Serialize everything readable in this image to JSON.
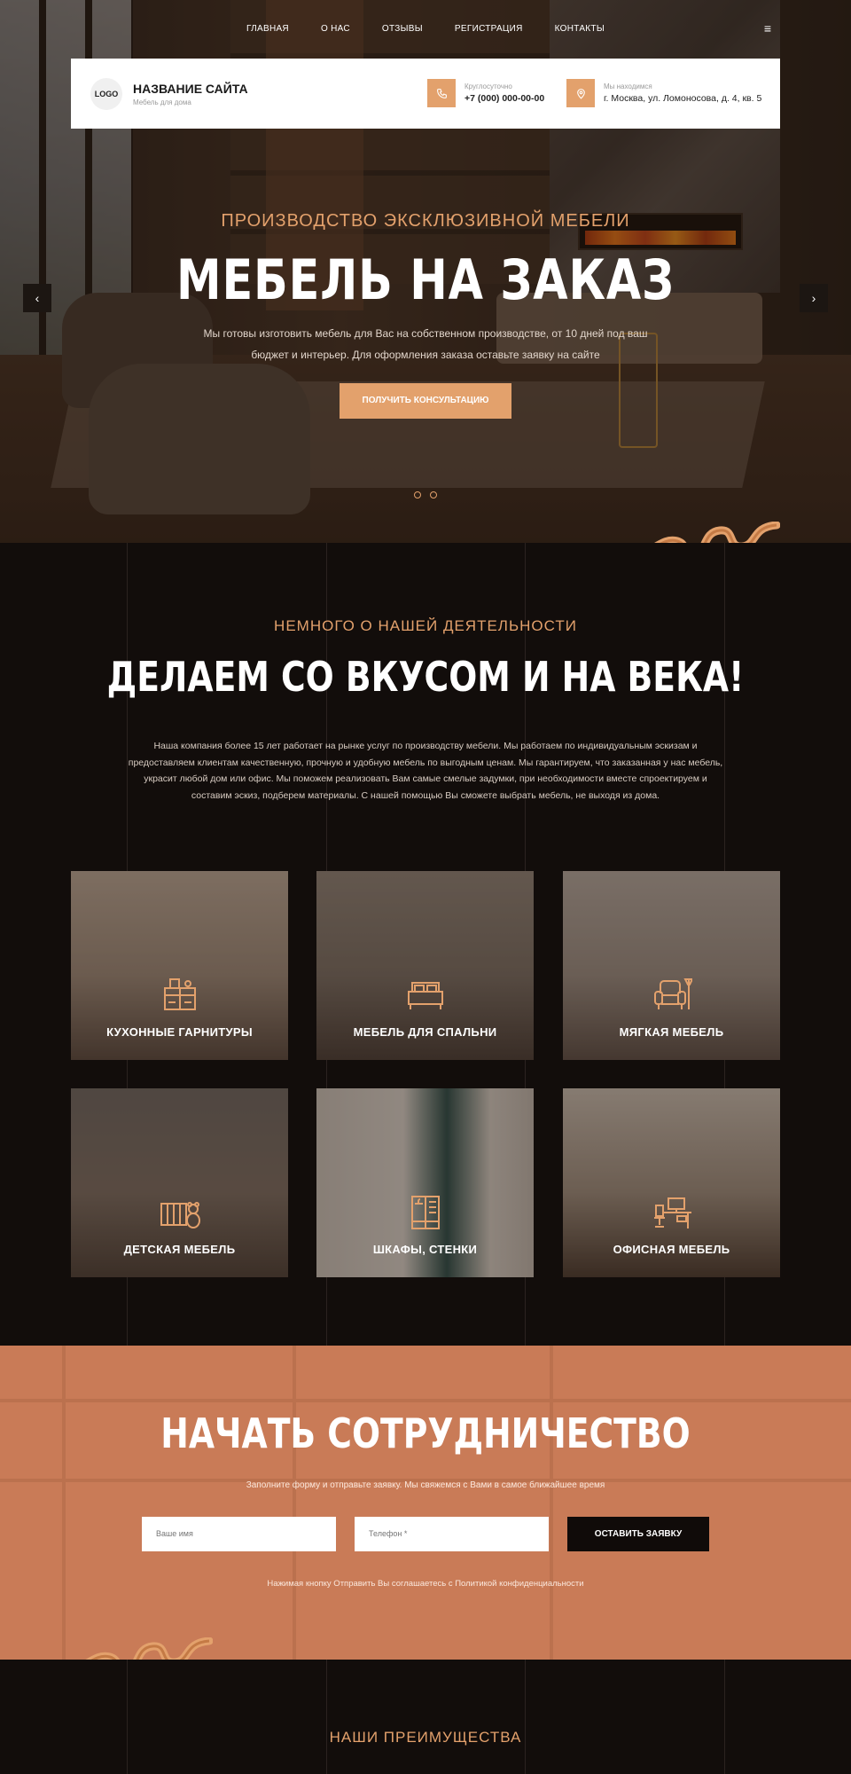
{
  "nav": {
    "items": [
      "ГЛАВНАЯ",
      "О НАС",
      "ОТЗЫВЫ",
      "РЕГИСТРАЦИЯ",
      "КОНТАКТЫ"
    ],
    "menu_icon": "hamburger-icon"
  },
  "header": {
    "logo": "LOGO",
    "site_name": "НАЗВАНИЕ САЙТА",
    "site_tagline": "Мебель для дома",
    "phone_label": "Круглосуточно",
    "phone": "+7 (000) 000-00-00",
    "address_label": "Мы находимся",
    "address": "г. Москва, ул. Ломоносова, д. 4, кв. 5"
  },
  "hero": {
    "subtitle": "ПРОИЗВОДСТВО ЭКСКЛЮЗИВНОЙ МЕБЕЛИ",
    "title": "МЕБЕЛЬ НА ЗАКАЗ",
    "description": "Мы готовы изготовить мебель для Вас на собственном производстве, от 10 дней под ваш бюджет и интерьер. Для оформления заказа оставьте заявку на сайте",
    "button": "ПОЛУЧИТЬ КОНСУЛЬТАЦИЮ",
    "prev_arrow": "‹",
    "next_arrow": "›",
    "slides_count": 2
  },
  "about": {
    "subtitle": "НЕМНОГО О НАШЕЙ ДЕЯТЕЛЬНОСТИ",
    "title": "ДЕЛАЕМ СО ВКУСОМ И НА ВЕКА!",
    "text": "Наша компания более 15 лет работает на рынке услуг по производству мебели. Мы работаем по индивидуальным эскизам и предоставляем клиентам качественную, прочную и удобную мебель по выгодным ценам. Мы гарантируем, что заказанная у нас мебель, украсит любой дом или офис. Мы поможем реализовать Вам самые смелые задумки, при необходимости вместе спроектируем и составим эскиз, подберем материалы. С нашей помощью Вы сможете выбрать мебель, не выходя из дома."
  },
  "categories": [
    {
      "label": "КУХОННЫЕ ГАРНИТУРЫ",
      "icon": "kitchen-icon"
    },
    {
      "label": "МЕБЕЛЬ ДЛЯ СПАЛЬНИ",
      "icon": "bed-icon"
    },
    {
      "label": "МЯГКАЯ МЕБЕЛЬ",
      "icon": "armchair-icon"
    },
    {
      "label": "ДЕТСКАЯ МЕБЕЛЬ",
      "icon": "crib-icon"
    },
    {
      "label": "ШКАФЫ, СТЕНКИ",
      "icon": "wardrobe-icon"
    },
    {
      "label": "ОФИСНАЯ МЕБЕЛЬ",
      "icon": "office-desk-icon"
    }
  ],
  "cooperation": {
    "title": "НАЧАТЬ СОТРУДНИЧЕСТВО",
    "description": "Заполните форму и отправьте заявку. Мы свяжемся с Вами в самое ближайшее время",
    "name_placeholder": "Ваше имя",
    "phone_placeholder": "Телефон *",
    "submit": "ОСТАВИТЬ ЗАЯВКУ",
    "consent": "Нажимая кнопку Отправить Вы соглашаетесь с Политикой конфиденциальности"
  },
  "advantages": {
    "subtitle": "НАШИ ПРЕИМУЩЕСТВА"
  },
  "colors": {
    "accent": "#e3a16c",
    "dark": "#120d0b",
    "cooperation_bg": "#c97b57"
  }
}
